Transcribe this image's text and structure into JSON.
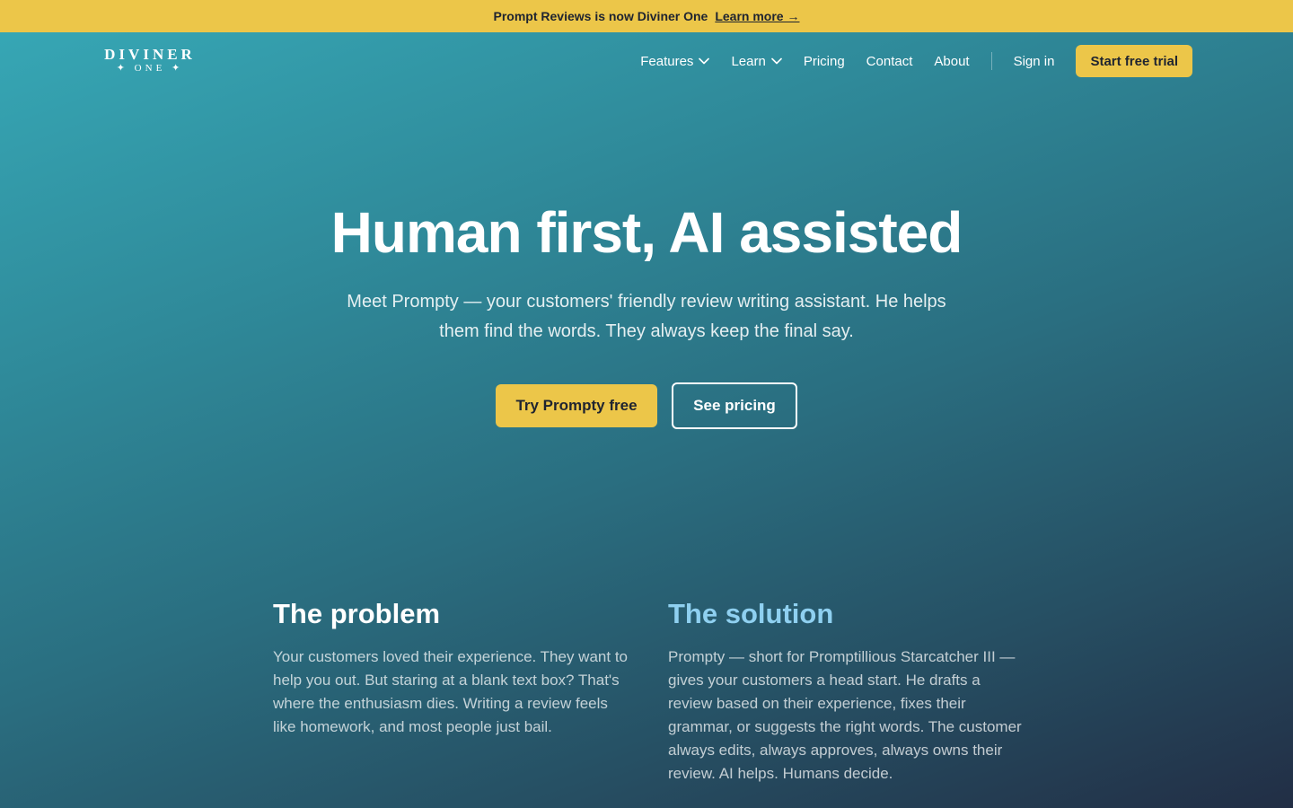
{
  "banner": {
    "text": "Prompt Reviews is now Diviner One",
    "link_label": "Learn more →"
  },
  "logo": {
    "line1": "DIVINER",
    "line2": "✦ ONE ✦"
  },
  "nav": {
    "items": [
      {
        "label": "Features",
        "has_dropdown": true
      },
      {
        "label": "Learn",
        "has_dropdown": true
      },
      {
        "label": "Pricing",
        "has_dropdown": false
      },
      {
        "label": "Contact",
        "has_dropdown": false
      },
      {
        "label": "About",
        "has_dropdown": false
      }
    ],
    "sign_in": "Sign in",
    "trial_button": "Start free trial"
  },
  "hero": {
    "title": "Human first, AI assisted",
    "subtitle": "Meet Prompty — your customers' friendly review writing assistant. He helps them find the words. They always keep the final say.",
    "primary_button": "Try Prompty free",
    "secondary_button": "See pricing"
  },
  "sections": {
    "problem": {
      "title": "The problem",
      "body": "Your customers loved their experience. They want to help you out. But staring at a blank text box? That's where the enthusiasm dies. Writing a review feels like homework, and most people just bail."
    },
    "solution": {
      "title": "The solution",
      "body": "Prompty — short for Promptillious Starcatcher III — gives your customers a head start. He drafts a review based on their experience, fixes their grammar, or suggests the right words. The customer always edits, always approves, always owns their review. AI helps. Humans decide."
    }
  },
  "colors": {
    "accent": "#ecc649",
    "solution_heading": "#8fd0f0"
  }
}
